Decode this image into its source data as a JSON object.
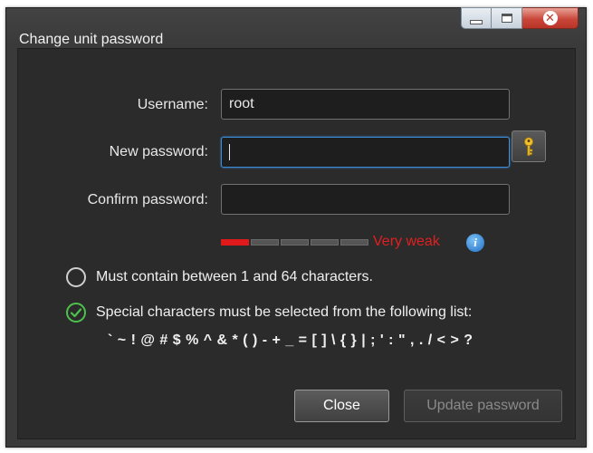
{
  "window": {
    "title": "Change unit password"
  },
  "form": {
    "username_label": "Username:",
    "username_value": "root",
    "new_password_label": "New password:",
    "new_password_value": "",
    "confirm_password_label": "Confirm password:",
    "confirm_password_value": ""
  },
  "strength": {
    "label": "Very weak",
    "level": 1,
    "segments": 5,
    "color": "#e02020"
  },
  "rules": {
    "length_rule": "Must contain between 1 and 64 characters.",
    "length_satisfied": false,
    "special_rule": "Special characters must be selected from the following list:",
    "special_satisfied": true,
    "special_chars": "` ~ ! @ # $ % ^ & * ( ) - + _ = [ ] \\ { } | ; ' : \" , . / < > ?"
  },
  "buttons": {
    "close_label": "Close",
    "update_label": "Update password"
  },
  "icons": {
    "key": "key-icon",
    "info": "info-icon",
    "minimize": "minimize-icon",
    "maximize": "maximize-icon",
    "close": "close-icon"
  },
  "colors": {
    "accent_focus": "#3c8bd6",
    "ok_green": "#4cc24c",
    "weak_red": "#e01a1a"
  }
}
